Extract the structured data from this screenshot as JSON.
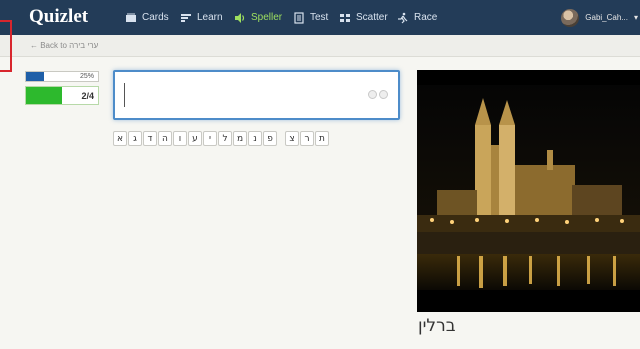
{
  "app": {
    "logo": "Quizlet"
  },
  "nav": {
    "items": [
      {
        "label": "Cards",
        "icon": "cards-icon"
      },
      {
        "label": "Learn",
        "icon": "learn-icon"
      },
      {
        "label": "Speller",
        "icon": "speaker-icon",
        "active": true
      },
      {
        "label": "Test",
        "icon": "test-icon"
      },
      {
        "label": "Scatter",
        "icon": "scatter-icon"
      },
      {
        "label": "Race",
        "icon": "race-icon"
      }
    ],
    "user": "Gabi_Cah..."
  },
  "subbar": {
    "back_link": "← Back to ערי בירה"
  },
  "progress": {
    "overall_label": "25%",
    "overall_value": 0.25,
    "round_label": "2/4",
    "round_value": 0.5
  },
  "answer": {
    "value": "",
    "placeholder": ""
  },
  "keyboard": {
    "keys": [
      "א",
      "ג",
      "ד",
      "ה",
      "ו",
      "ע",
      "י",
      "ל",
      "מ",
      "נ",
      "פ",
      "צ",
      "ר",
      "ת"
    ]
  },
  "term": {
    "text": "ברלין"
  },
  "colors": {
    "topbar": "#233c58",
    "active_nav": "#9ee05f",
    "progress_blue": "#1f5fa8",
    "progress_green": "#2db92d",
    "input_border": "#4d8cc9",
    "highlight_frame": "#d8262d"
  }
}
